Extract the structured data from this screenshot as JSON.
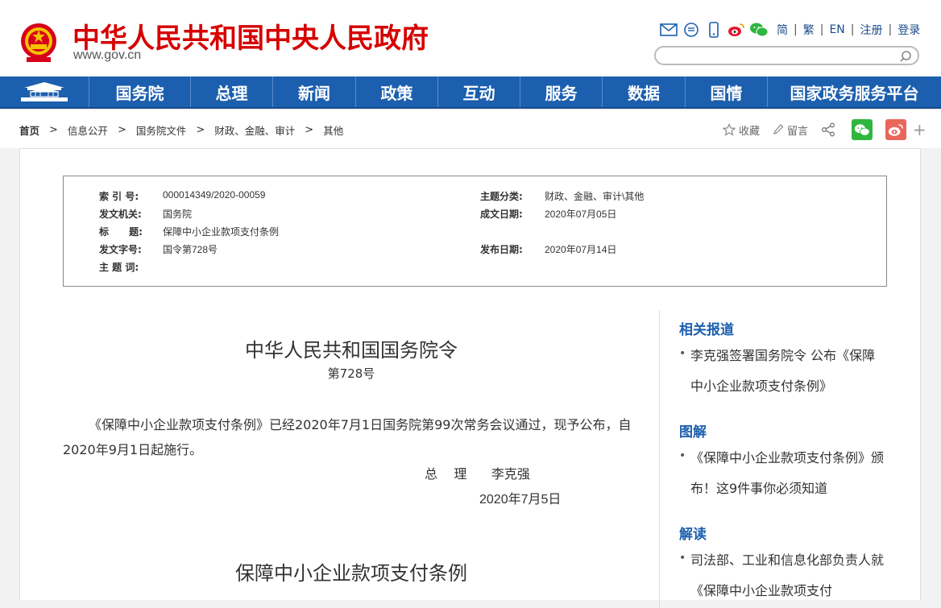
{
  "header": {
    "site_title": "中华人民共和国中央人民政府",
    "site_url": "www.gov.cn",
    "lang_links": [
      "简",
      "繁",
      "EN",
      "注册",
      "登录"
    ],
    "search_placeholder": ""
  },
  "nav": {
    "items": [
      "国务院",
      "总理",
      "新闻",
      "政策",
      "互动",
      "服务",
      "数据",
      "国情",
      "国家政务服务平台"
    ]
  },
  "breadcrumb": {
    "items": [
      "首页",
      "信息公开",
      "国务院文件",
      "财政、金融、审计",
      "其他"
    ]
  },
  "share": {
    "collect_label": "收藏",
    "comment_label": "留言",
    "more_label": "+"
  },
  "info": {
    "index_label": "索 引 号:",
    "index_value": "000014349/2020-00059",
    "topic_label": "主题分类:",
    "topic_value": "财政、金融、审计\\其他",
    "issuer_label": "发文机关:",
    "issuer_value": "国务院",
    "written_label": "成文日期:",
    "written_value": "2020年07月05日",
    "title_label": "标      题:",
    "title_value": "保障中小企业款项支付条例",
    "docno_label": "发文字号:",
    "docno_value": "国令第728号",
    "published_label": "发布日期:",
    "published_value": "2020年07月14日",
    "keywords_label": "主 题 词:",
    "keywords_value": ""
  },
  "article": {
    "title": "中华人民共和国国务院令",
    "number": "第728号",
    "paragraph": "《保障中小企业款项支付条例》已经2020年7月1日国务院第99次常务会议通过，现予公布，自2020年9月1日起施行。",
    "sign": "总    理      李克强",
    "date": "2020年7月5日",
    "title2": "保障中小企业款项支付条例"
  },
  "sidebar": {
    "related_heading": "相关报道",
    "related_item": "李克强签署国务院令 公布《保障中小企业款项支付条例》",
    "graphic_heading": "图解",
    "graphic_item": "《保障中小企业款项支付条例》颁布！这9件事你必须知道",
    "interpret_heading": "解读",
    "interpret_item": "司法部、工业和信息化部负责人就《保障中小企业款项支付"
  },
  "colors": {
    "brand_red": "#d60000",
    "nav_blue": "#1c5fae",
    "wechat_green": "#2fb63f",
    "weibo_red": "#e8675a"
  }
}
